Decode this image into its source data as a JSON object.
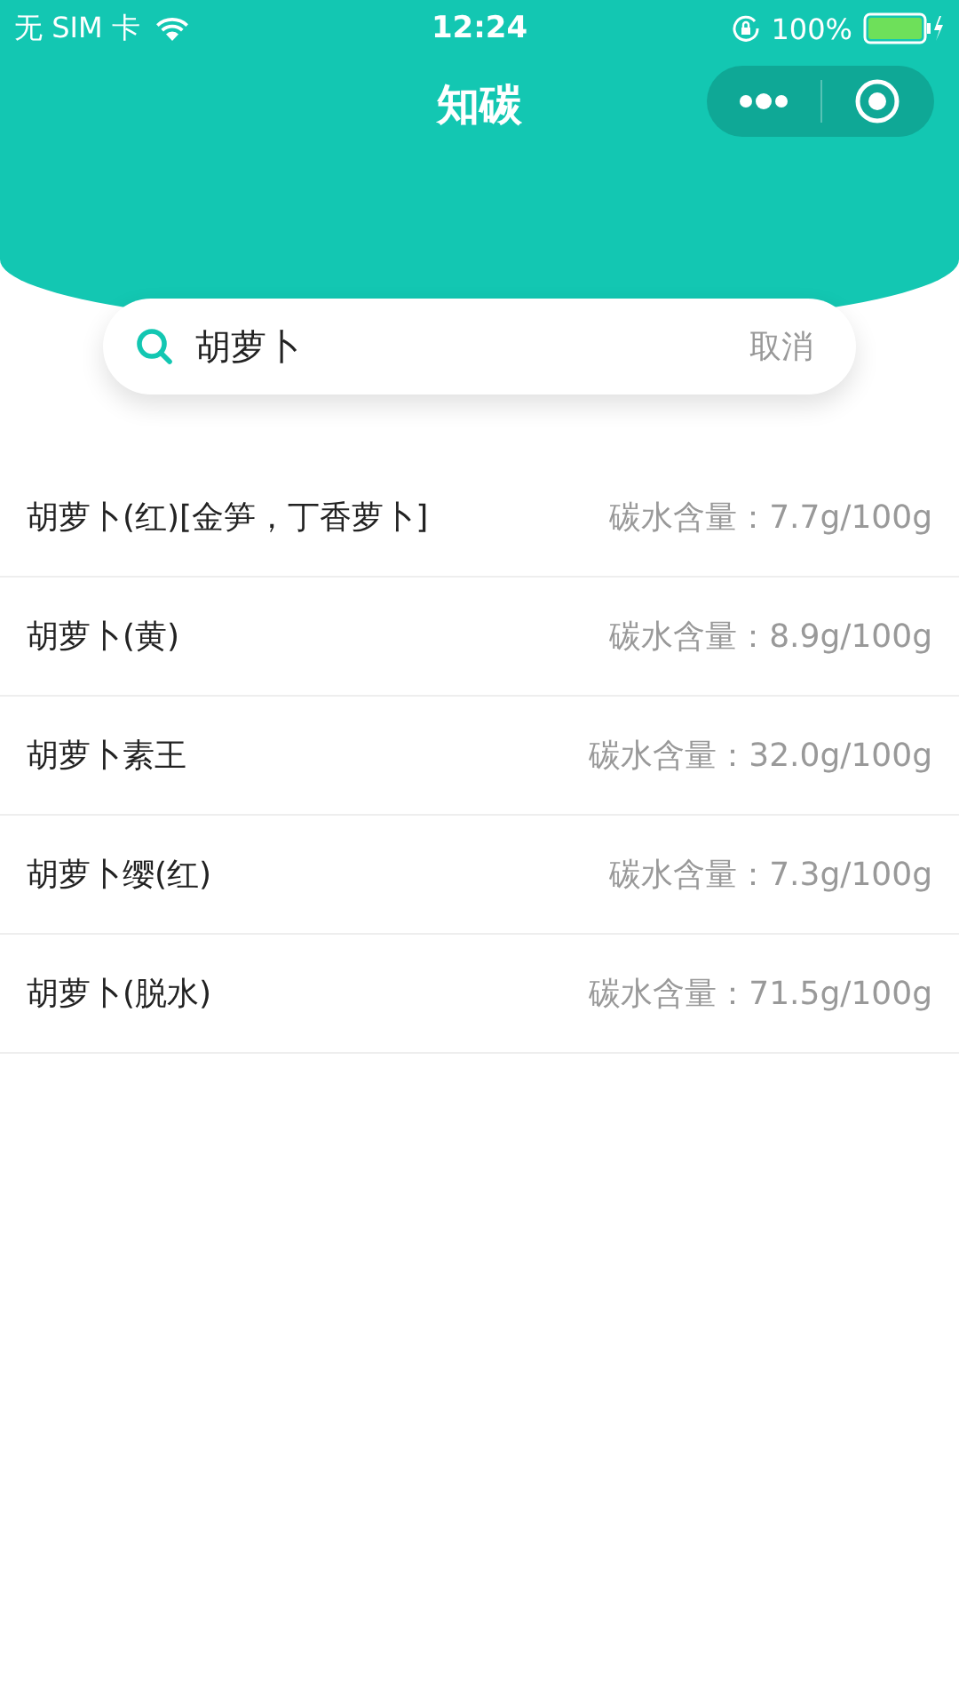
{
  "status_bar": {
    "carrier": "无 SIM 卡",
    "time": "12:24",
    "battery": "100%"
  },
  "nav": {
    "title": "知碳"
  },
  "search": {
    "value": "胡萝卜",
    "cancel": "取消"
  },
  "results": [
    {
      "name": "胡萝卜(红)[金笋，丁香萝卜]",
      "carbs": "碳水含量：7.7g/100g"
    },
    {
      "name": "胡萝卜(黄)",
      "carbs": "碳水含量：8.9g/100g"
    },
    {
      "name": "胡萝卜素王",
      "carbs": "碳水含量：32.0g/100g"
    },
    {
      "name": "胡萝卜缨(红)",
      "carbs": "碳水含量：7.3g/100g"
    },
    {
      "name": "胡萝卜(脱水)",
      "carbs": "碳水含量：71.5g/100g"
    }
  ]
}
